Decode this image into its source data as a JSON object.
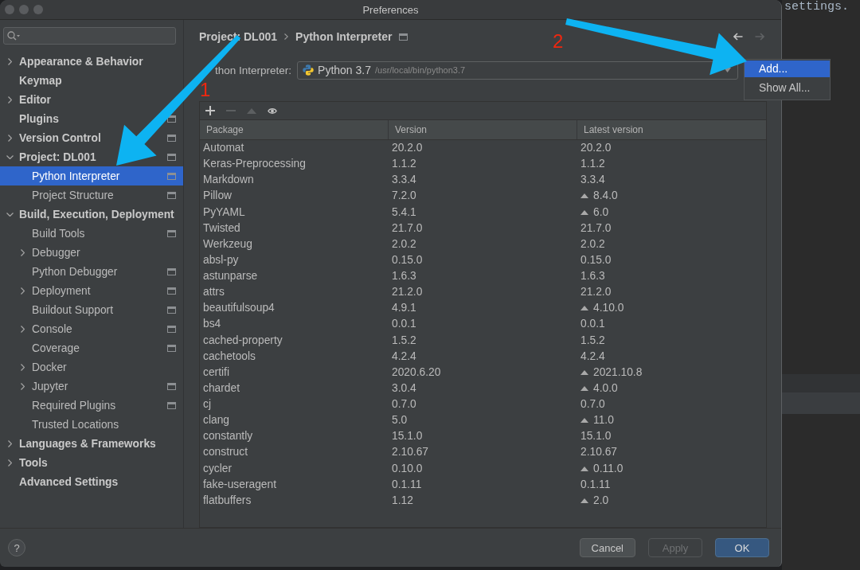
{
  "window": {
    "title": "Preferences"
  },
  "sidebar": {
    "items": [
      {
        "label": "Appearance & Behavior",
        "expanded": false,
        "project_level": false,
        "selected": false
      },
      {
        "label": "Keymap",
        "project_level": false,
        "selected": false
      },
      {
        "label": "Editor",
        "expanded": false,
        "project_level": false,
        "selected": false
      },
      {
        "label": "Plugins",
        "project_level": true,
        "selected": false
      },
      {
        "label": "Version Control",
        "expanded": false,
        "project_level": true,
        "selected": false
      },
      {
        "label": "Project: DL001",
        "expanded": true,
        "project_level": true,
        "selected": false,
        "children": [
          {
            "label": "Python Interpreter",
            "project_level": true,
            "selected": true
          },
          {
            "label": "Project Structure",
            "project_level": true,
            "selected": false
          }
        ]
      },
      {
        "label": "Build, Execution, Deployment",
        "expanded": true,
        "project_level": false,
        "selected": false,
        "children": [
          {
            "label": "Build Tools",
            "project_level": true,
            "selected": false
          },
          {
            "label": "Debugger",
            "expanded": false,
            "project_level": false,
            "selected": false
          },
          {
            "label": "Python Debugger",
            "project_level": true,
            "selected": false
          },
          {
            "label": "Deployment",
            "expanded": false,
            "project_level": true,
            "selected": false
          },
          {
            "label": "Buildout Support",
            "project_level": true,
            "selected": false
          },
          {
            "label": "Console",
            "expanded": false,
            "project_level": true,
            "selected": false
          },
          {
            "label": "Coverage",
            "project_level": true,
            "selected": false
          },
          {
            "label": "Docker",
            "expanded": false,
            "project_level": false,
            "selected": false
          },
          {
            "label": "Jupyter",
            "expanded": false,
            "project_level": true,
            "selected": false
          },
          {
            "label": "Required Plugins",
            "project_level": true,
            "selected": false
          },
          {
            "label": "Trusted Locations",
            "project_level": false,
            "selected": false
          }
        ]
      },
      {
        "label": "Languages & Frameworks",
        "expanded": false,
        "project_level": false,
        "selected": false
      },
      {
        "label": "Tools",
        "expanded": false,
        "project_level": false,
        "selected": false
      },
      {
        "label": "Advanced Settings",
        "project_level": false,
        "selected": false
      }
    ]
  },
  "breadcrumb": {
    "items": [
      "Project: DL001",
      "Python Interpreter"
    ],
    "project_level": true
  },
  "navigation": [
    {
      "kind": "back",
      "disabled": false
    },
    {
      "kind": "forward",
      "disabled": true
    }
  ],
  "interpreter": {
    "label": "thon Interpreter:",
    "name": "Python 3.7",
    "path": "/usr/local/bin/python3.7"
  },
  "interpreter_menu": [
    {
      "label": "Add...",
      "selected": true
    },
    {
      "label": "Show All...",
      "selected": false
    }
  ],
  "packages_toolbar": [
    {
      "kind": "add",
      "disabled": false
    },
    {
      "kind": "remove",
      "disabled": true
    },
    {
      "kind": "upgrade",
      "disabled": true
    },
    {
      "kind": "view",
      "disabled": false
    }
  ],
  "table": {
    "columns": [
      "Package",
      "Version",
      "Latest version"
    ],
    "rows": [
      {
        "package": "Automat",
        "version": "20.2.0",
        "latest": "20.2.0",
        "upgrade": false
      },
      {
        "package": "Keras-Preprocessing",
        "version": "1.1.2",
        "latest": "1.1.2",
        "upgrade": false
      },
      {
        "package": "Markdown",
        "version": "3.3.4",
        "latest": "3.3.4",
        "upgrade": false
      },
      {
        "package": "Pillow",
        "version": "7.2.0",
        "latest": "8.4.0",
        "upgrade": true
      },
      {
        "package": "PyYAML",
        "version": "5.4.1",
        "latest": "6.0",
        "upgrade": true
      },
      {
        "package": "Twisted",
        "version": "21.7.0",
        "latest": "21.7.0",
        "upgrade": false
      },
      {
        "package": "Werkzeug",
        "version": "2.0.2",
        "latest": "2.0.2",
        "upgrade": false
      },
      {
        "package": "absl-py",
        "version": "0.15.0",
        "latest": "0.15.0",
        "upgrade": false
      },
      {
        "package": "astunparse",
        "version": "1.6.3",
        "latest": "1.6.3",
        "upgrade": false
      },
      {
        "package": "attrs",
        "version": "21.2.0",
        "latest": "21.2.0",
        "upgrade": false
      },
      {
        "package": "beautifulsoup4",
        "version": "4.9.1",
        "latest": "4.10.0",
        "upgrade": true
      },
      {
        "package": "bs4",
        "version": "0.0.1",
        "latest": "0.0.1",
        "upgrade": false
      },
      {
        "package": "cached-property",
        "version": "1.5.2",
        "latest": "1.5.2",
        "upgrade": false
      },
      {
        "package": "cachetools",
        "version": "4.2.4",
        "latest": "4.2.4",
        "upgrade": false
      },
      {
        "package": "certifi",
        "version": "2020.6.20",
        "latest": "2021.10.8",
        "upgrade": true
      },
      {
        "package": "chardet",
        "version": "3.0.4",
        "latest": "4.0.0",
        "upgrade": true
      },
      {
        "package": "cj",
        "version": "0.7.0",
        "latest": "0.7.0",
        "upgrade": false
      },
      {
        "package": "clang",
        "version": "5.0",
        "latest": "11.0",
        "upgrade": true
      },
      {
        "package": "constantly",
        "version": "15.1.0",
        "latest": "15.1.0",
        "upgrade": false
      },
      {
        "package": "construct",
        "version": "2.10.67",
        "latest": "2.10.67",
        "upgrade": false
      },
      {
        "package": "cycler",
        "version": "0.10.0",
        "latest": "0.11.0",
        "upgrade": true
      },
      {
        "package": "fake-useragent",
        "version": "0.1.11",
        "latest": "0.1.11",
        "upgrade": false
      },
      {
        "package": "flatbuffers",
        "version": "1.12",
        "latest": "2.0",
        "upgrade": true
      }
    ]
  },
  "footer": {
    "help": "?",
    "buttons": [
      {
        "label": "Cancel",
        "kind": "normal",
        "disabled": false
      },
      {
        "label": "Apply",
        "kind": "normal",
        "disabled": true
      },
      {
        "label": "OK",
        "kind": "default",
        "disabled": false
      }
    ]
  },
  "editor": {
    "text": "settings."
  },
  "annotations": [
    {
      "number": "1"
    },
    {
      "number": "2"
    }
  ]
}
